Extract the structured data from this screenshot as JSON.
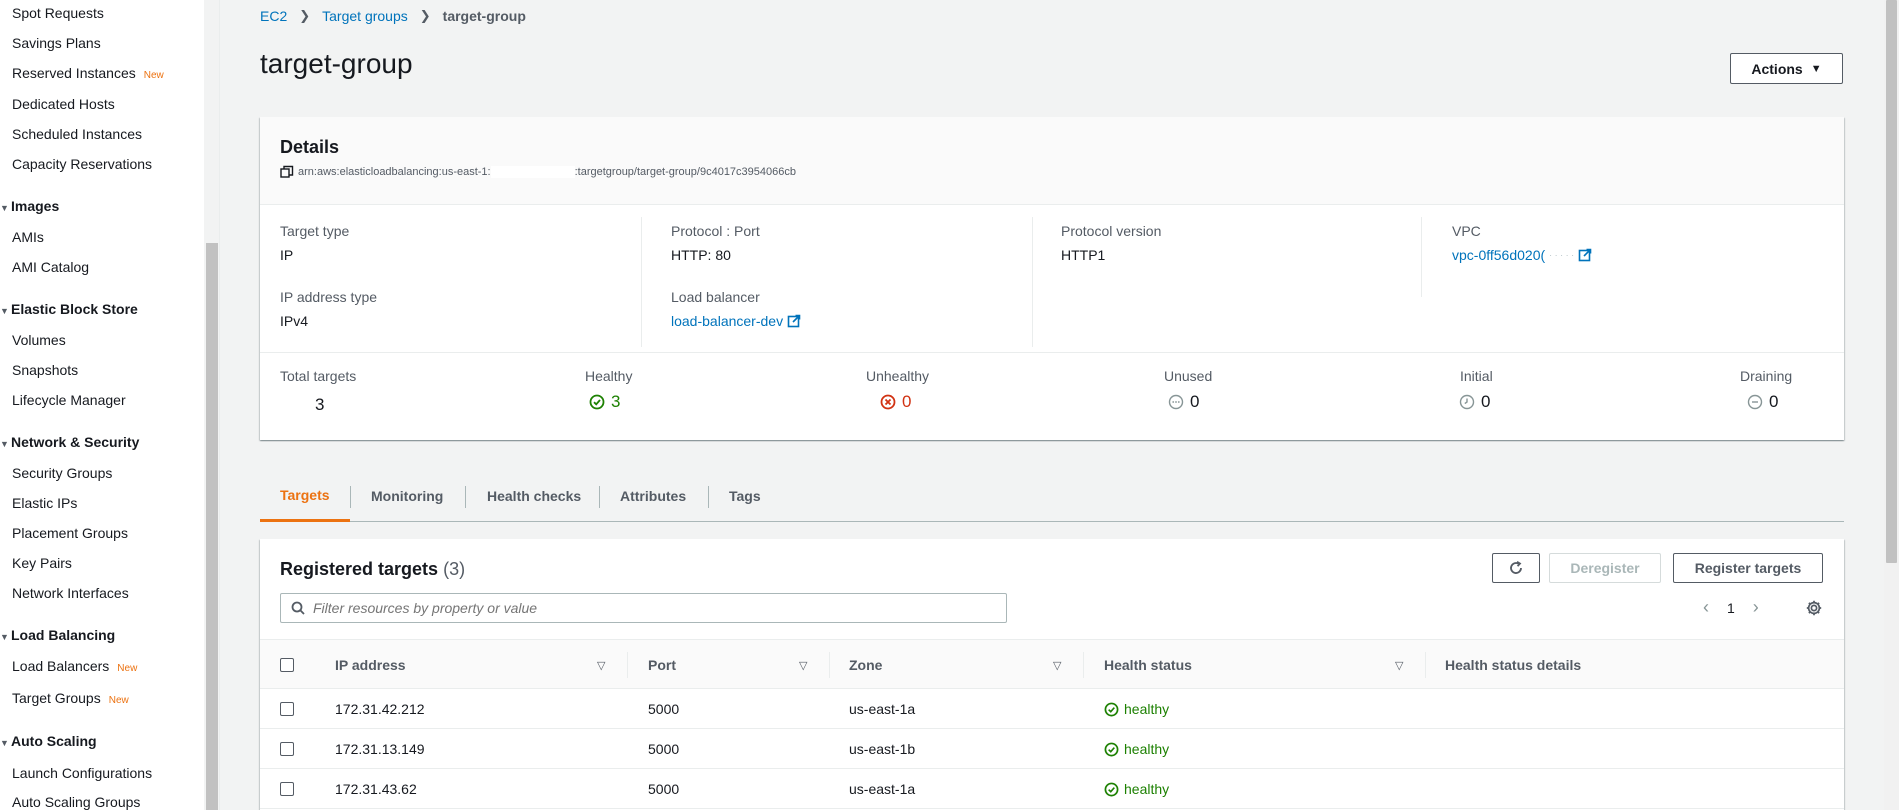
{
  "sidebar": {
    "items_top": [
      "Spot Requests",
      "Savings Plans",
      "Reserved Instances",
      "Dedicated Hosts",
      "Scheduled Instances",
      "Capacity Reservations"
    ],
    "new_badge": "New",
    "sections": [
      {
        "title": "Images",
        "items": [
          "AMIs",
          "AMI Catalog"
        ]
      },
      {
        "title": "Elastic Block Store",
        "items": [
          "Volumes",
          "Snapshots",
          "Lifecycle Manager"
        ]
      },
      {
        "title": "Network & Security",
        "items": [
          "Security Groups",
          "Elastic IPs",
          "Placement Groups",
          "Key Pairs",
          "Network Interfaces"
        ]
      },
      {
        "title": "Load Balancing",
        "items": [
          "Load Balancers",
          "Target Groups"
        ]
      },
      {
        "title": "Auto Scaling",
        "items": [
          "Launch Configurations",
          "Auto Scaling Groups"
        ]
      }
    ]
  },
  "breadcrumb": [
    "EC2",
    "Target groups",
    "target-group"
  ],
  "page_title": "target-group",
  "actions_label": "Actions",
  "details": {
    "title": "Details",
    "arn_prefix": "arn:aws:elasticloadbalancing:us-east-1:",
    "arn_suffix": ":targetgroup/target-group/9c4017c3954066cb",
    "target_type_label": "Target type",
    "target_type": "IP",
    "ip_type_label": "IP address type",
    "ip_type": "IPv4",
    "protocol_port_label": "Protocol : Port",
    "protocol_port": "HTTP: 80",
    "load_balancer_label": "Load balancer",
    "load_balancer": "load-balancer-dev",
    "protocol_version_label": "Protocol version",
    "protocol_version": "HTTP1",
    "vpc_label": "VPC",
    "vpc": "vpc-0ff56d020(",
    "vpc_obscured": "  ·  ·  ·  ·  ·  "
  },
  "stats": {
    "total_label": "Total targets",
    "total": "3",
    "healthy_label": "Healthy",
    "healthy": "3",
    "unhealthy_label": "Unhealthy",
    "unhealthy": "0",
    "unused_label": "Unused",
    "unused": "0",
    "initial_label": "Initial",
    "initial": "0",
    "draining_label": "Draining",
    "draining": "0"
  },
  "colors": {
    "accent": "#ec7211",
    "link": "#0073bb",
    "healthy": "#1d8102",
    "unhealthy": "#d13212"
  },
  "tabs": [
    "Targets",
    "Monitoring",
    "Health checks",
    "Attributes",
    "Tags"
  ],
  "registered": {
    "title": "Registered targets",
    "count": "(3)",
    "deregister_label": "Deregister",
    "register_label": "Register targets",
    "filter_placeholder": "Filter resources by property or value",
    "page": "1",
    "columns": [
      "IP address",
      "Port",
      "Zone",
      "Health status",
      "Health status details"
    ],
    "rows": [
      {
        "ip": "172.31.42.212",
        "port": "5000",
        "zone": "us-east-1a",
        "health": "healthy",
        "details": ""
      },
      {
        "ip": "172.31.13.149",
        "port": "5000",
        "zone": "us-east-1b",
        "health": "healthy",
        "details": ""
      },
      {
        "ip": "172.31.43.62",
        "port": "5000",
        "zone": "us-east-1a",
        "health": "healthy",
        "details": ""
      }
    ]
  }
}
